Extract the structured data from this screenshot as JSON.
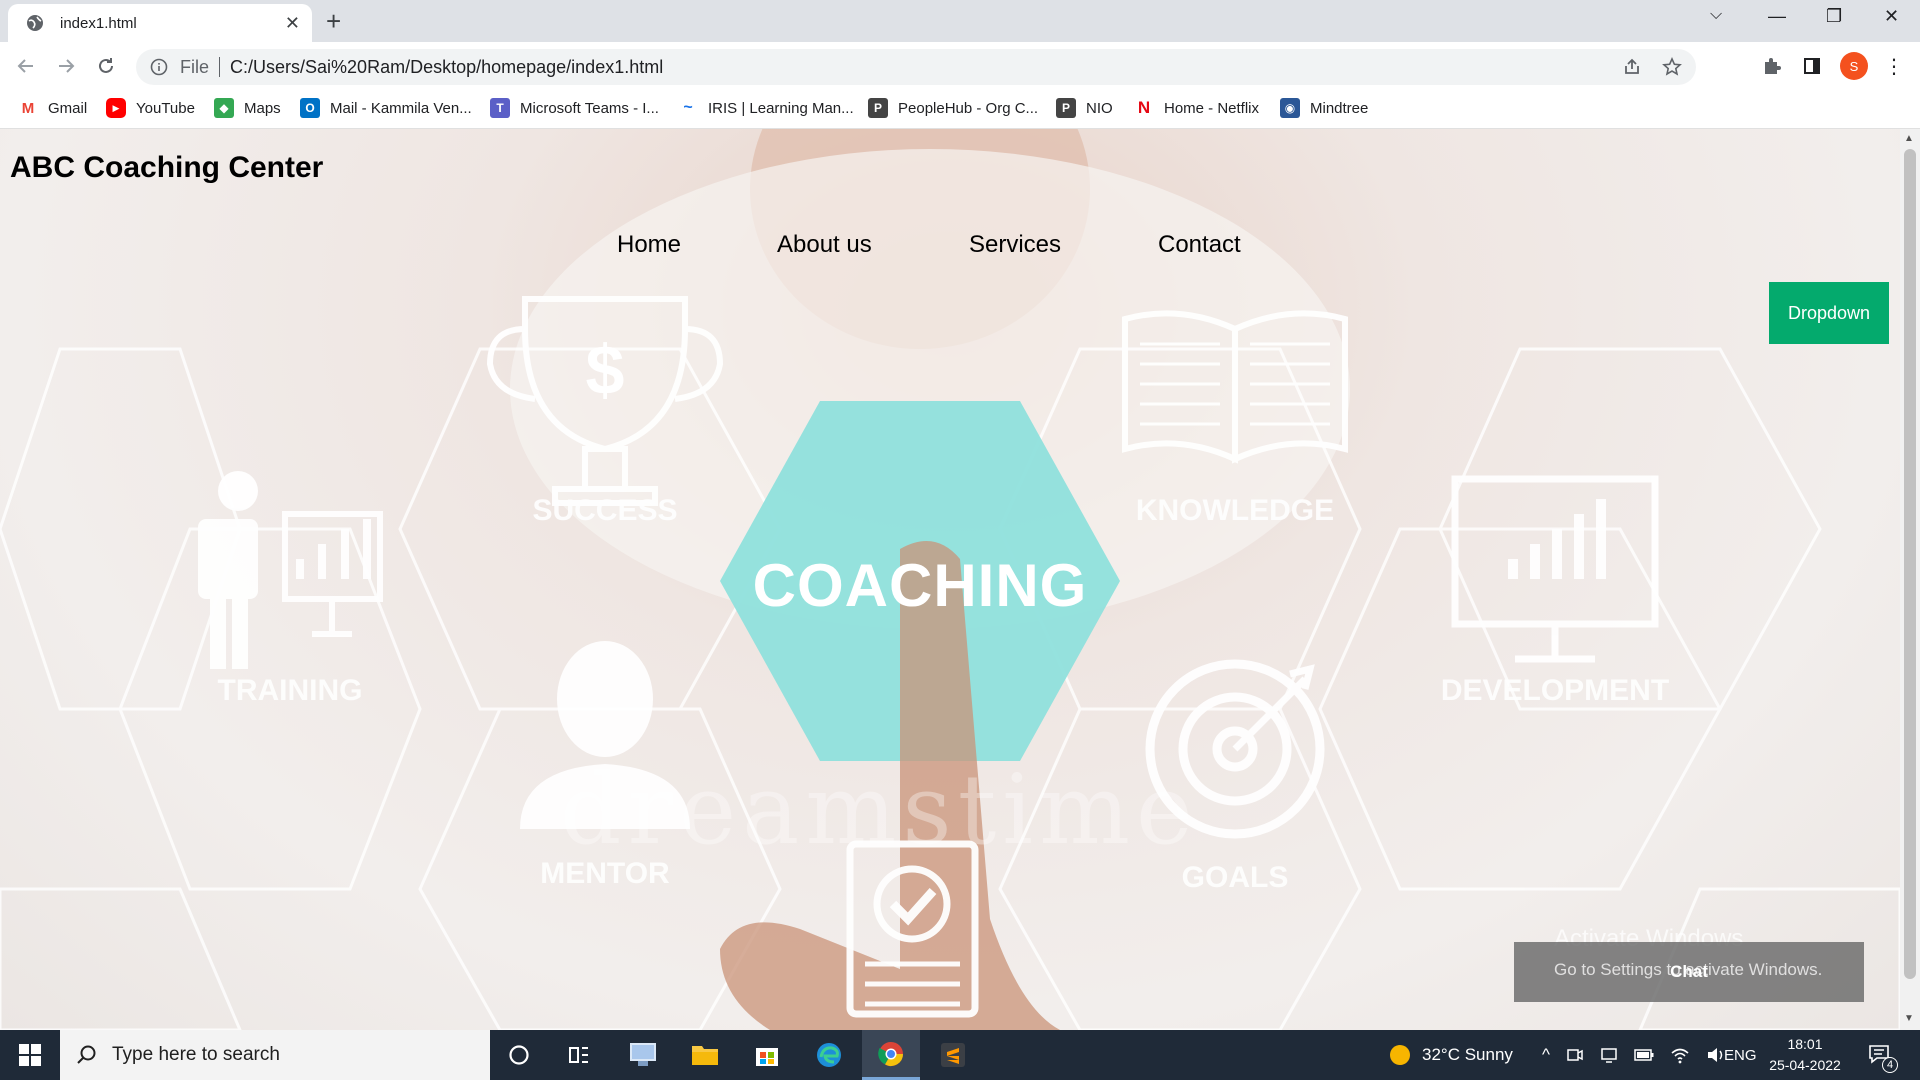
{
  "browser": {
    "tab_title": "index1.html",
    "new_tab_symbol": "+",
    "omnibox_label": "File",
    "url": "C:/Users/Sai%20Ram/Desktop/homepage/index1.html",
    "profile_initial": "S"
  },
  "bookmarks": [
    {
      "label": "Gmail",
      "icon": "gmail-icon",
      "color": "#ea4335",
      "glyph": "M"
    },
    {
      "label": "YouTube",
      "icon": "youtube-icon",
      "color": "#ff0000",
      "glyph": "▶"
    },
    {
      "label": "Maps",
      "icon": "maps-icon",
      "color": "#34a853",
      "glyph": "◆"
    },
    {
      "label": "Mail - Kammila Ven...",
      "icon": "outlook-icon",
      "color": "#0072c6",
      "glyph": "O"
    },
    {
      "label": "Microsoft Teams - I...",
      "icon": "teams-icon",
      "color": "#5b5fc7",
      "glyph": "T"
    },
    {
      "label": "IRIS | Learning Man...",
      "icon": "iris-icon",
      "color": "#1a73e8",
      "glyph": "~"
    },
    {
      "label": "PeopleHub - Org C...",
      "icon": "peoplehub-icon",
      "color": "#444444",
      "glyph": "P"
    },
    {
      "label": "NIO",
      "icon": "nio-icon",
      "color": "#444444",
      "glyph": "P"
    },
    {
      "label": "Home - Netflix",
      "icon": "netflix-icon",
      "color": "#e50914",
      "glyph": "N"
    },
    {
      "label": "Mindtree",
      "icon": "mindtree-icon",
      "color": "#2b5797",
      "glyph": "◉"
    }
  ],
  "site": {
    "title": "ABC Coaching Center",
    "nav": [
      "Home",
      "About us",
      "Services",
      "Contact"
    ],
    "dropdown_label": "Dropdown",
    "chat_label": "Chat",
    "hero_words": {
      "center": "COACHING",
      "success": "SUCCESS",
      "knowledge": "KNOWLEDGE",
      "training": "TRAINING",
      "development": "DEVELOPMENT",
      "mentor": "MENTOR",
      "goals": "GOALS",
      "watermark": "dreamstime"
    },
    "accent_color": "#04aa6d",
    "hexagon_color": "#8fe0dc"
  },
  "windows_overlay": {
    "line1": "Activate Windows",
    "line2": "Go to Settings to activate Windows."
  },
  "taskbar": {
    "search_placeholder": "Type here to search",
    "weather": "32°C  Sunny",
    "language": "ENG",
    "time": "18:01",
    "date": "25-04-2022",
    "notification_count": "4"
  }
}
